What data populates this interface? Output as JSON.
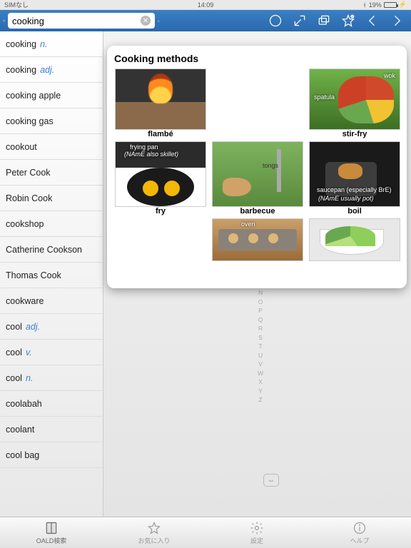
{
  "status": {
    "carrier": "SIMなし",
    "time": "14:09",
    "battery_pct": "19%"
  },
  "toolbar": {
    "search_value": "cooking"
  },
  "sidebar": {
    "items": [
      {
        "label": "cooking",
        "pos": "n."
      },
      {
        "label": "cooking",
        "pos": "adj."
      },
      {
        "label": "cooking apple",
        "pos": ""
      },
      {
        "label": "cooking gas",
        "pos": ""
      },
      {
        "label": "cookout",
        "pos": ""
      },
      {
        "label": "Peter Cook",
        "pos": ""
      },
      {
        "label": "Robin Cook",
        "pos": ""
      },
      {
        "label": "cookshop",
        "pos": ""
      },
      {
        "label": "Catherine Cookson",
        "pos": ""
      },
      {
        "label": "Thomas Cook",
        "pos": ""
      },
      {
        "label": "cookware",
        "pos": ""
      },
      {
        "label": "cool",
        "pos": "adj."
      },
      {
        "label": "cool",
        "pos": "v."
      },
      {
        "label": "cool",
        "pos": "n."
      },
      {
        "label": "coolabah",
        "pos": ""
      },
      {
        "label": "coolant",
        "pos": ""
      },
      {
        "label": "cool bag",
        "pos": ""
      }
    ]
  },
  "popover": {
    "title": "Cooking methods",
    "cells": [
      {
        "caption": "flambé",
        "labels": []
      },
      {
        "caption": "stir-fry",
        "labels": [
          "wok",
          "spatula"
        ]
      },
      {
        "caption": "fry",
        "labels": [
          "frying pan",
          "(NAmE also skillet)"
        ]
      },
      {
        "caption": "barbecue",
        "labels": [
          "tongs"
        ]
      },
      {
        "caption": "boil",
        "labels": [
          "saucepan (especially BrE)",
          "(NAmE usually pot)"
        ]
      },
      {
        "caption": "",
        "labels": [
          "oven"
        ]
      },
      {
        "caption": "",
        "labels": []
      }
    ]
  },
  "alpha": [
    "N",
    "O",
    "P",
    "Q",
    "R",
    "S",
    "T",
    "U",
    "V",
    "W",
    "X",
    "Y",
    "Z"
  ],
  "tabs": [
    {
      "label": "OALD検索"
    },
    {
      "label": "お気に入り"
    },
    {
      "label": "設定"
    },
    {
      "label": "ヘルプ"
    }
  ]
}
